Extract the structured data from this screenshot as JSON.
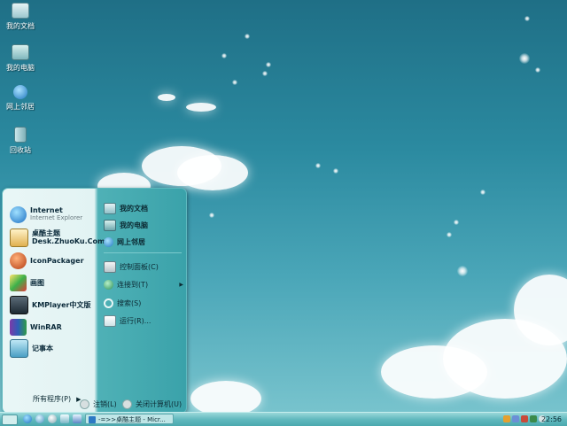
{
  "desktop": {
    "icons": [
      {
        "label": "我的文档"
      },
      {
        "label": "我的电脑"
      },
      {
        "label": "网上邻居"
      },
      {
        "label": "回收站"
      }
    ]
  },
  "start_menu": {
    "programs": [
      {
        "name": "Internet",
        "sub": "Internet Explorer",
        "icon": "ie-icon"
      },
      {
        "name": "桌酷主题",
        "sub": "Desk.ZhuoKu.Com",
        "icon": "zhuoku-icon"
      },
      {
        "name": "IconPackager",
        "sub": "",
        "icon": "iconpackager-icon"
      },
      {
        "name": "画图",
        "sub": "",
        "icon": "paint-icon"
      },
      {
        "name": "KMPlayer中文版",
        "sub": "",
        "icon": "kmplayer-icon"
      },
      {
        "name": "WinRAR",
        "sub": "",
        "icon": "winrar-icon"
      },
      {
        "name": "记事本",
        "sub": "",
        "icon": "notepad-icon"
      }
    ],
    "all_programs": "所有程序(P)",
    "places": [
      {
        "label": "我的文档"
      },
      {
        "label": "我的电脑"
      },
      {
        "label": "网上邻居"
      }
    ],
    "system": [
      {
        "label": "控制面板(C)"
      },
      {
        "label": "连接到(T)"
      },
      {
        "label": "搜索(S)"
      },
      {
        "label": "运行(R)..."
      }
    ],
    "logoff": "注销(L)",
    "shutdown": "关闭计算机(U)"
  },
  "taskbar": {
    "task_label": "-=>>桌酷主题 - Micr...",
    "clock": "22:56"
  },
  "colors": {
    "accent": "#3aa2aa",
    "taskbar": "#61b9be",
    "menu_left_bg": "#e9f6f6"
  }
}
